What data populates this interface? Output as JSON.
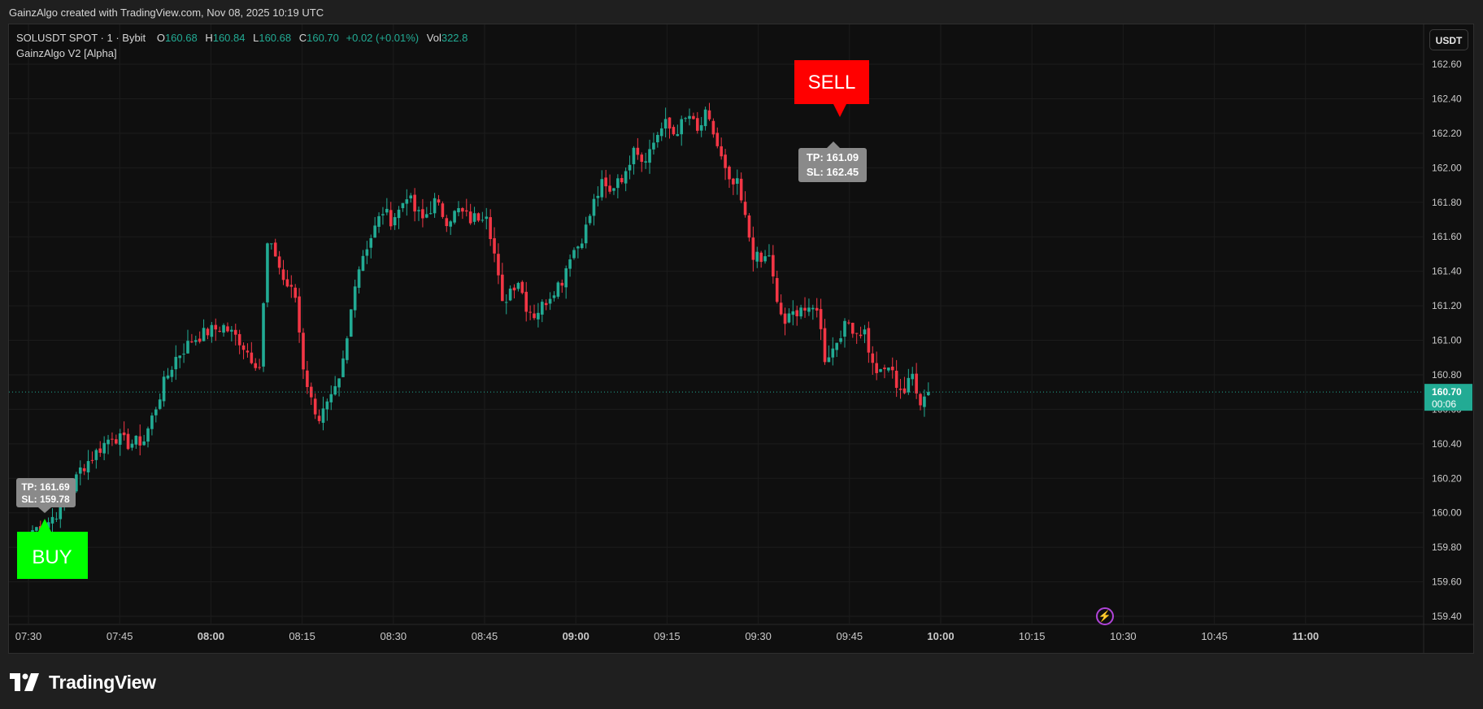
{
  "header": {
    "caption": "GainzAlgo created with TradingView.com, Nov 08, 2025 10:19 UTC"
  },
  "legend": {
    "symbol": "SOLUSDT SPOT · 1 · Bybit",
    "open_label": "O",
    "open": "160.68",
    "high_label": "H",
    "high": "160.84",
    "low_label": "L",
    "low": "160.68",
    "close_label": "C",
    "close": "160.70",
    "change": "+0.02 (+0.01%)",
    "vol_label": "Vol",
    "vol": "322.8"
  },
  "indicator": "GainzAlgo V2 [Alpha]",
  "currency_button": "USDT",
  "brand": {
    "text": "TradingView"
  },
  "colors": {
    "up": "#22ab94",
    "down": "#f23645",
    "background": "#0f0f0f",
    "buy": "#00ff00",
    "sell": "#ff0000",
    "lightning": "#b044d8"
  },
  "icons": {
    "lightning": "lightning-icon",
    "logo": "tradingview-logo-icon"
  },
  "chart_data": {
    "type": "candlestick",
    "ylim": [
      159.3,
      162.7
    ],
    "y_ticks": [
      "162.60",
      "162.40",
      "162.20",
      "162.00",
      "161.80",
      "161.60",
      "161.40",
      "161.20",
      "161.00",
      "160.80",
      "160.60",
      "160.40",
      "160.20",
      "160.00",
      "159.80",
      "159.60",
      "159.40"
    ],
    "x_ticks": [
      "07:30",
      "07:45",
      "08:00",
      "08:15",
      "08:30",
      "08:45",
      "09:00",
      "09:15",
      "09:30",
      "09:45",
      "10:00",
      "10:15",
      "10:30",
      "10:45",
      "11:00"
    ],
    "last_price": "160.70",
    "countdown": "00:06",
    "close_path": [
      [
        0,
        159.9
      ],
      [
        4,
        159.95
      ],
      [
        8,
        160.05
      ],
      [
        12,
        160.25
      ],
      [
        16,
        160.35
      ],
      [
        20,
        160.45
      ],
      [
        24,
        160.4
      ],
      [
        28,
        160.42
      ],
      [
        30,
        160.55
      ],
      [
        33,
        160.75
      ],
      [
        36,
        160.9
      ],
      [
        40,
        161.0
      ],
      [
        44,
        161.05
      ],
      [
        48,
        161.08
      ],
      [
        52,
        161.0
      ],
      [
        55,
        160.9
      ],
      [
        57,
        160.85
      ],
      [
        59,
        161.55
      ],
      [
        61,
        161.5
      ],
      [
        63,
        161.35
      ],
      [
        66,
        161.25
      ],
      [
        68,
        160.85
      ],
      [
        70,
        160.65
      ],
      [
        72,
        160.55
      ],
      [
        75,
        160.65
      ],
      [
        77,
        160.75
      ],
      [
        79,
        161.0
      ],
      [
        81,
        161.35
      ],
      [
        83,
        161.5
      ],
      [
        85,
        161.6
      ],
      [
        88,
        161.75
      ],
      [
        90,
        161.7
      ],
      [
        92,
        161.75
      ],
      [
        94,
        161.85
      ],
      [
        96,
        161.75
      ],
      [
        98,
        161.7
      ],
      [
        101,
        161.8
      ],
      [
        104,
        161.7
      ],
      [
        107,
        161.75
      ],
      [
        110,
        161.7
      ],
      [
        112,
        161.72
      ],
      [
        114,
        161.75
      ],
      [
        116,
        161.5
      ],
      [
        118,
        161.2
      ],
      [
        120,
        161.3
      ],
      [
        122,
        161.35
      ],
      [
        124,
        161.2
      ],
      [
        126,
        161.15
      ],
      [
        128,
        161.2
      ],
      [
        131,
        161.3
      ],
      [
        133,
        161.35
      ],
      [
        135,
        161.5
      ],
      [
        137,
        161.55
      ],
      [
        139,
        161.65
      ],
      [
        141,
        161.8
      ],
      [
        143,
        161.9
      ],
      [
        145,
        161.85
      ],
      [
        147,
        161.95
      ],
      [
        149,
        161.95
      ],
      [
        151,
        162.15
      ],
      [
        153,
        162.05
      ],
      [
        155,
        162.1
      ],
      [
        157,
        162.2
      ],
      [
        159,
        162.25
      ],
      [
        161,
        162.2
      ],
      [
        163,
        162.25
      ],
      [
        165,
        162.3
      ],
      [
        167,
        162.2
      ],
      [
        169,
        162.3
      ],
      [
        171,
        162.2
      ],
      [
        173,
        162.05
      ],
      [
        175,
        161.9
      ],
      [
        177,
        161.9
      ],
      [
        179,
        161.7
      ],
      [
        181,
        161.5
      ],
      [
        183,
        161.45
      ],
      [
        185,
        161.5
      ],
      [
        187,
        161.2
      ],
      [
        189,
        161.1
      ],
      [
        191,
        161.15
      ],
      [
        193,
        161.2
      ],
      [
        195,
        161.15
      ],
      [
        197,
        161.2
      ],
      [
        199,
        160.9
      ],
      [
        201,
        160.95
      ],
      [
        203,
        161.05
      ],
      [
        205,
        161.1
      ],
      [
        207,
        161.05
      ],
      [
        209,
        161.05
      ],
      [
        211,
        160.85
      ],
      [
        213,
        160.8
      ],
      [
        215,
        160.85
      ],
      [
        217,
        160.75
      ],
      [
        219,
        160.7
      ],
      [
        221,
        160.8
      ],
      [
        223,
        160.65
      ],
      [
        225,
        160.7
      ]
    ],
    "signals": [
      {
        "label": "BUY",
        "tp": "TP: 161.69",
        "sl": "SL: 159.78"
      },
      {
        "label": "SELL",
        "tp": "TP: 161.09",
        "sl": "SL: 162.45"
      }
    ]
  }
}
